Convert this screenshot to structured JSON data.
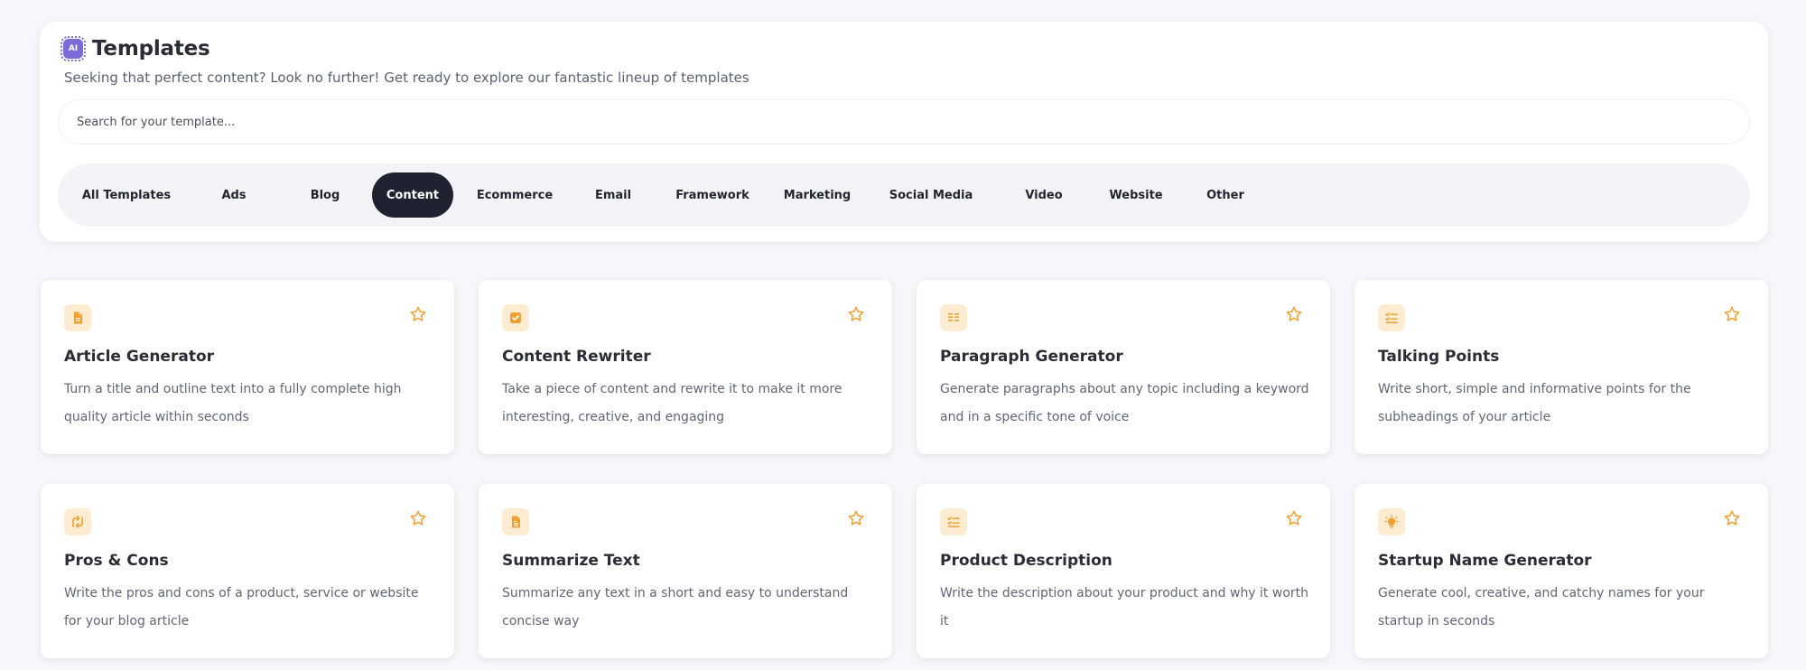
{
  "header": {
    "badge_text": "AI",
    "title": "Templates",
    "subtitle": "Seeking that perfect content? Look no further! Get ready to explore our fantastic lineup of templates"
  },
  "search": {
    "placeholder": "Search for your template..."
  },
  "filters": [
    {
      "label": "All Templates",
      "active": false
    },
    {
      "label": "Ads",
      "active": false
    },
    {
      "label": "Blog",
      "active": false
    },
    {
      "label": "Content",
      "active": true
    },
    {
      "label": "Ecommerce",
      "active": false
    },
    {
      "label": "Email",
      "active": false
    },
    {
      "label": "Framework",
      "active": false
    },
    {
      "label": "Marketing",
      "active": false
    },
    {
      "label": "Social Media",
      "active": false
    },
    {
      "label": "Video",
      "active": false
    },
    {
      "label": "Website",
      "active": false
    },
    {
      "label": "Other",
      "active": false
    }
  ],
  "cards": [
    {
      "icon": "document-icon",
      "title": "Article Generator",
      "description": "Turn a title and outline text into a fully complete high quality article within seconds"
    },
    {
      "icon": "checkbox-icon",
      "title": "Content Rewriter",
      "description": "Take a piece of content and rewrite it to make it more interesting, creative, and engaging"
    },
    {
      "icon": "paragraph-icon",
      "title": "Paragraph Generator",
      "description": "Generate paragraphs about any topic including a keyword and in a specific tone of voice"
    },
    {
      "icon": "checklist-icon",
      "title": "Talking Points",
      "description": "Write short, simple and informative points for the subheadings of your article"
    },
    {
      "icon": "swap-icon",
      "title": "Pros & Cons",
      "description": "Write the pros and cons of a product, service or website for your blog article"
    },
    {
      "icon": "file-text-icon",
      "title": "Summarize Text",
      "description": "Summarize any text in a short and easy to understand concise way"
    },
    {
      "icon": "checklist-icon",
      "title": "Product Description",
      "description": "Write the description about your product and why it worth it"
    },
    {
      "icon": "lightbulb-icon",
      "title": "Startup Name Generator",
      "description": "Generate cool, creative, and catchy names for your startup in seconds"
    }
  ],
  "colors": {
    "accent": "#f0a030",
    "icon_bg": "#fdebd2",
    "active_chip": "#1f2130",
    "ai_badge": "#7a6bd9"
  }
}
